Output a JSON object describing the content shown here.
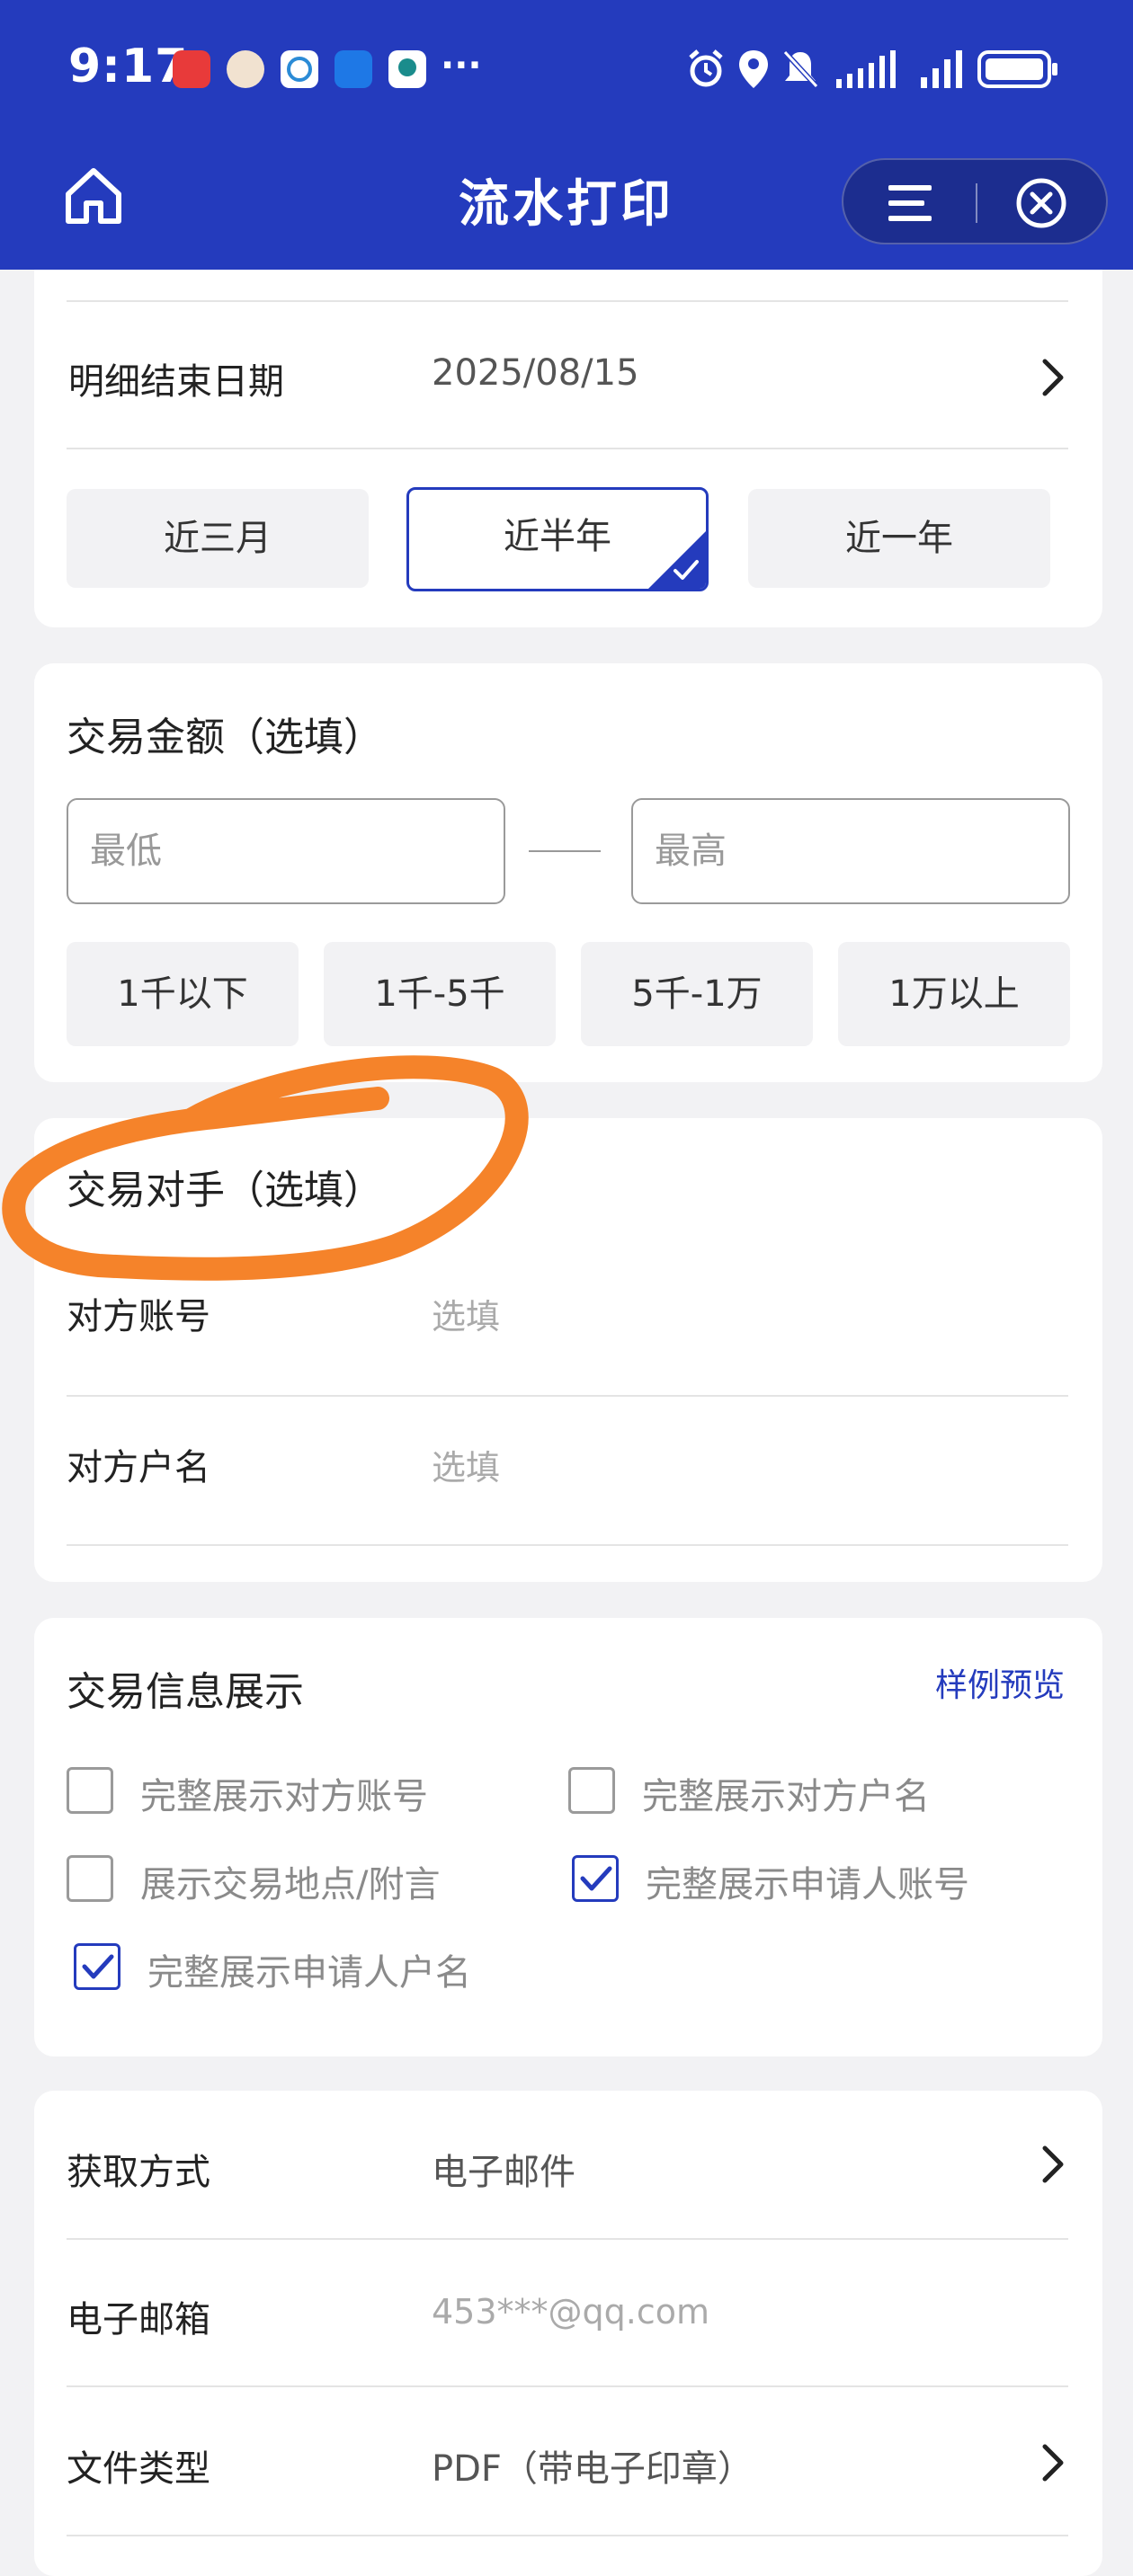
{
  "status_bar": {
    "time": "9:17",
    "more": "···",
    "icons": [
      "huawei-store-icon",
      "avatar-app-icon",
      "message-app-icon",
      "zhijia-app-icon",
      "location-app-icon",
      "alarm-icon",
      "location-icon",
      "mute-icon",
      "signal-icon",
      "signal-icon",
      "battery-icon"
    ]
  },
  "header": {
    "title": "流水打印"
  },
  "date_card": {
    "end_date_label": "明细结束日期",
    "end_date_value": "2025/08/15",
    "presets": [
      "近三月",
      "近半年",
      "近一年"
    ],
    "selected_preset": "近半年"
  },
  "amount_card": {
    "title": "交易金额（选填）",
    "min_placeholder": "最低",
    "max_placeholder": "最高",
    "ranges": [
      "1千以下",
      "1千-5千",
      "5千-1万",
      "1万以上"
    ]
  },
  "counterparty_card": {
    "title": "交易对手（选填）",
    "account_label": "对方账号",
    "account_placeholder": "选填",
    "name_label": "对方户名",
    "name_placeholder": "选填"
  },
  "display_card": {
    "title": "交易信息展示",
    "preview_link": "样例预览",
    "options": [
      {
        "label": "完整展示对方账号",
        "checked": false
      },
      {
        "label": "完整展示对方户名",
        "checked": false
      },
      {
        "label": "展示交易地点/附言",
        "checked": false
      },
      {
        "label": "完整展示申请人账号",
        "checked": true
      },
      {
        "label": "完整展示申请人户名",
        "checked": true
      }
    ]
  },
  "delivery_card": {
    "method_label": "获取方式",
    "method_value": "电子邮件",
    "email_label": "电子邮箱",
    "email_value": "453***@qq.com",
    "filetype_label": "文件类型",
    "filetype_value": "PDF（带电子印章）"
  },
  "colors": {
    "brand": "#243bbd",
    "annotation": "#f5832a",
    "page_bg": "#f2f2f4"
  }
}
